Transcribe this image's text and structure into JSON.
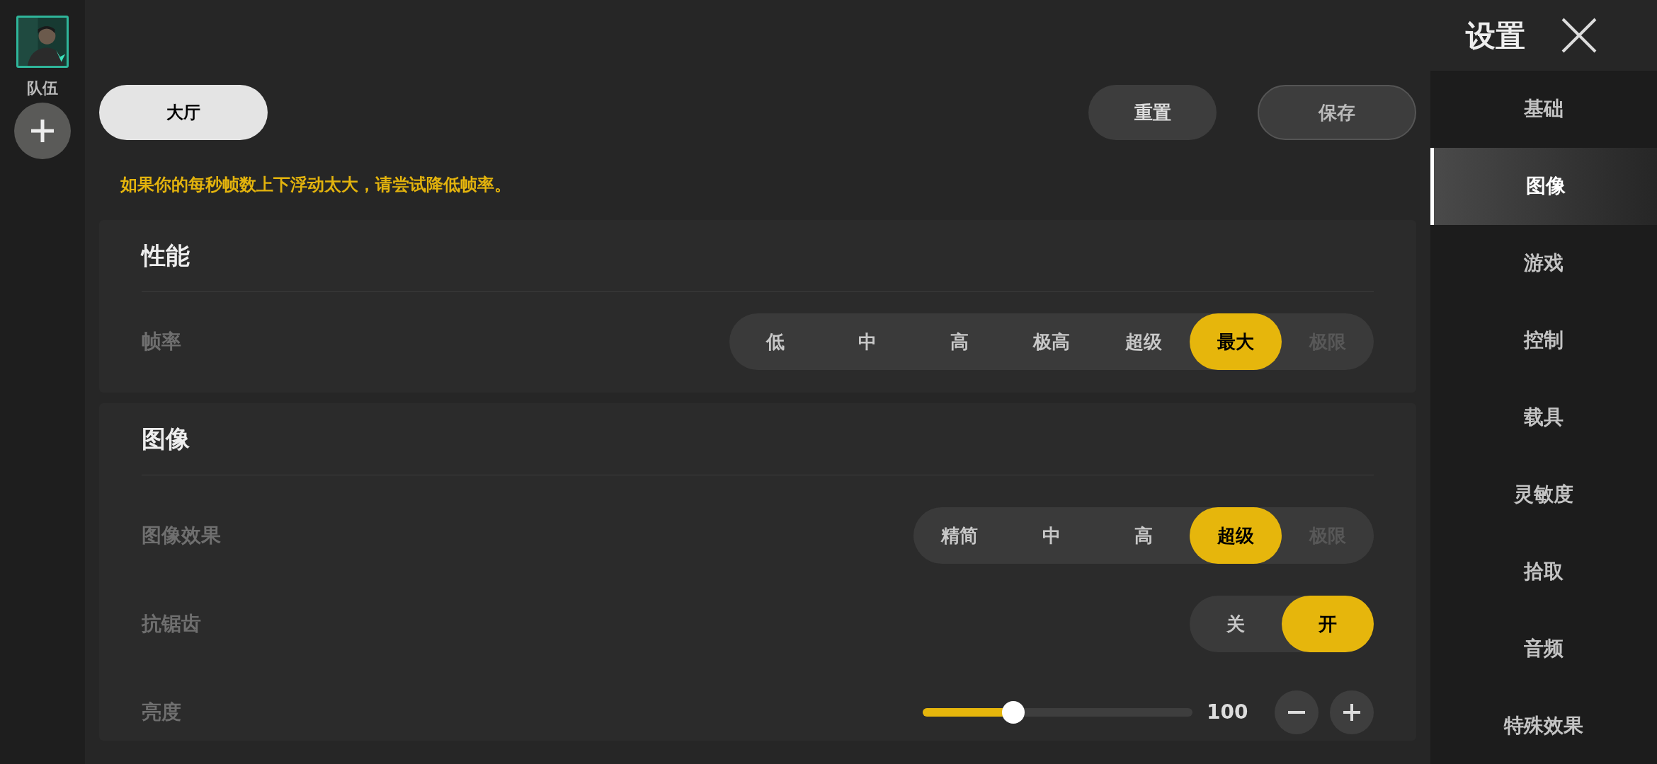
{
  "team": {
    "label": "队伍"
  },
  "top_bar": {
    "tab": {
      "label": "大厅",
      "selected": true
    },
    "buttons": [
      "重置",
      "保存"
    ]
  },
  "notice": "如果你的每秒帧数上下浮动太大，请尝试降低帧率。",
  "sections": [
    {
      "title": "性能",
      "rows": [
        {
          "kind": "segmented",
          "label": "帧率",
          "options": [
            {
              "label": "低",
              "selected": false,
              "disabled": false
            },
            {
              "label": "中",
              "selected": false,
              "disabled": false
            },
            {
              "label": "高",
              "selected": false,
              "disabled": false
            },
            {
              "label": "极高",
              "selected": false,
              "disabled": false
            },
            {
              "label": "超级",
              "selected": false,
              "disabled": false
            },
            {
              "label": "最大",
              "selected": true,
              "disabled": false
            },
            {
              "label": "极限",
              "selected": false,
              "disabled": true
            }
          ]
        }
      ]
    },
    {
      "title": "图像",
      "rows": [
        {
          "kind": "segmented",
          "label": "图像效果",
          "options": [
            {
              "label": "精简",
              "selected": false,
              "disabled": false
            },
            {
              "label": "中",
              "selected": false,
              "disabled": false
            },
            {
              "label": "高",
              "selected": false,
              "disabled": false
            },
            {
              "label": "超级",
              "selected": true,
              "disabled": false
            },
            {
              "label": "极限",
              "selected": false,
              "disabled": true
            }
          ]
        },
        {
          "kind": "segmented",
          "label": "抗锯齿",
          "options": [
            {
              "label": "关",
              "selected": false,
              "disabled": false
            },
            {
              "label": "开",
              "selected": true,
              "disabled": false
            }
          ]
        },
        {
          "kind": "slider",
          "label": "亮度",
          "level": 0.32,
          "reading": "100"
        }
      ]
    }
  ],
  "settings_panel": {
    "title": "设置",
    "nav": [
      {
        "label": "基础",
        "selected": false
      },
      {
        "label": "图像",
        "selected": true
      },
      {
        "label": "游戏",
        "selected": false
      },
      {
        "label": "控制",
        "selected": false
      },
      {
        "label": "载具",
        "selected": false
      },
      {
        "label": "灵敏度",
        "selected": false
      },
      {
        "label": "拾取",
        "selected": false
      },
      {
        "label": "音频",
        "selected": false
      },
      {
        "label": "特殊效果",
        "selected": false
      }
    ]
  }
}
